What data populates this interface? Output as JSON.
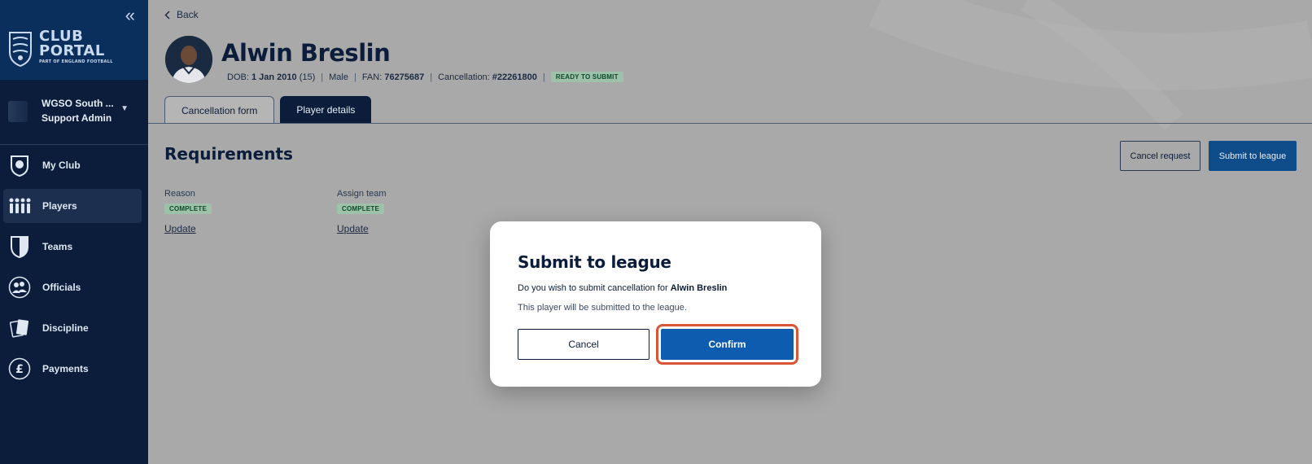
{
  "sidebar": {
    "collapse_icon": "double-chevron-left-icon",
    "logo": {
      "line1": "CLUB",
      "line2": "PORTAL",
      "sub": "PART OF ENGLAND FOOTBALL"
    },
    "org": {
      "name": "WGSO South ...",
      "role": "Support Admin"
    },
    "nav": [
      {
        "label": "My Club",
        "icon": "shield-ball-icon"
      },
      {
        "label": "Players",
        "icon": "players-icon"
      },
      {
        "label": "Teams",
        "icon": "team-shield-icon"
      },
      {
        "label": "Officials",
        "icon": "officials-icon"
      },
      {
        "label": "Discipline",
        "icon": "cards-icon"
      },
      {
        "label": "Payments",
        "icon": "pound-icon"
      }
    ],
    "active_nav": "Players"
  },
  "header": {
    "back_label": "Back",
    "player_name": "Alwin Breslin",
    "dob_label": "DOB:",
    "dob_value": "1 Jan 2010",
    "age": "(15)",
    "gender": "Male",
    "fan_label": "FAN:",
    "fan_value": "76275687",
    "cancellation_label": "Cancellation:",
    "cancellation_value": "#22261800",
    "status": "READY TO SUBMIT"
  },
  "tabs": [
    {
      "label": "Cancellation form",
      "active": true
    },
    {
      "label": "Player details",
      "active": false
    }
  ],
  "requirements": {
    "title": "Requirements",
    "cancel_request_label": "Cancel request",
    "submit_label": "Submit to league",
    "items": [
      {
        "label": "Reason",
        "status": "COMPLETE",
        "link": "Update"
      },
      {
        "label": "Assign team",
        "status": "COMPLETE",
        "link": "Update"
      }
    ]
  },
  "modal": {
    "title": "Submit to league",
    "line1_prefix": "Do you wish to submit cancellation for",
    "line1_name": "Alwin Breslin",
    "line2": "This player will be submitted to the league.",
    "cancel_label": "Cancel",
    "confirm_label": "Confirm"
  },
  "colors": {
    "sidebar": "#0b1d3a",
    "brand": "#0a2f5c",
    "primary": "#0e5cb0",
    "highlight": "#d9553a",
    "badge_bg": "#9ec1aa"
  }
}
